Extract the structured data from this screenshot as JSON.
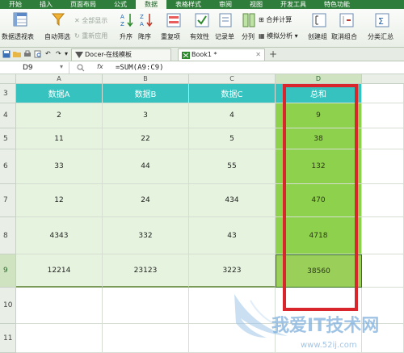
{
  "menu": {
    "items": [
      "开始",
      "插入",
      "页面布局",
      "公式",
      "数据",
      "表格样式",
      "审阅",
      "视图",
      "开发工具",
      "特色功能"
    ],
    "active": "数据"
  },
  "ribbon": {
    "pivot": "数据透视表",
    "autofilter": "自动筛选",
    "show_all": "全部显示",
    "reapply": "重新应用",
    "sort_asc": "升序",
    "sort_desc": "降序",
    "duplicates": "重复项",
    "validity": "有效性",
    "record": "记录单",
    "split": "分列",
    "consolidate": "合并计算",
    "what_if": "模拟分析",
    "group": "创建组",
    "ungroup": "取消组合",
    "subtotal": "分类汇总"
  },
  "tabs": {
    "docer": "Docer-在线模板",
    "book": "Book1 *"
  },
  "formula_bar": {
    "name_box": "D9",
    "fx": "fx",
    "formula": "=SUM(A9:C9)"
  },
  "grid": {
    "columns": [
      "A",
      "B",
      "C",
      "D"
    ],
    "rows": [
      {
        "num": "3",
        "cells": [
          "数据A",
          "数据B",
          "数据C",
          "总和"
        ]
      },
      {
        "num": "4",
        "cells": [
          "2",
          "3",
          "4",
          "9"
        ]
      },
      {
        "num": "5",
        "cells": [
          "11",
          "22",
          "5",
          "38"
        ]
      },
      {
        "num": "6",
        "cells": [
          "33",
          "44",
          "55",
          "132"
        ]
      },
      {
        "num": "7",
        "cells": [
          "12",
          "24",
          "434",
          "470"
        ]
      },
      {
        "num": "8",
        "cells": [
          "4343",
          "332",
          "43",
          "4718"
        ]
      },
      {
        "num": "9",
        "cells": [
          "12214",
          "23123",
          "3223",
          "38560"
        ]
      },
      {
        "num": "10",
        "cells": [
          "",
          "",
          "",
          ""
        ]
      },
      {
        "num": "11",
        "cells": [
          "",
          "",
          "",
          ""
        ]
      }
    ]
  },
  "watermark": {
    "brand": "我爱IT技术网",
    "url": "www.52ij.com"
  },
  "colors": {
    "header_fill": "#36c3bf",
    "data_fill": "#e6f4df",
    "sum_fill": "#8ed14c",
    "highlight": "#d8262c",
    "menu_bar": "#2f7d3b"
  }
}
